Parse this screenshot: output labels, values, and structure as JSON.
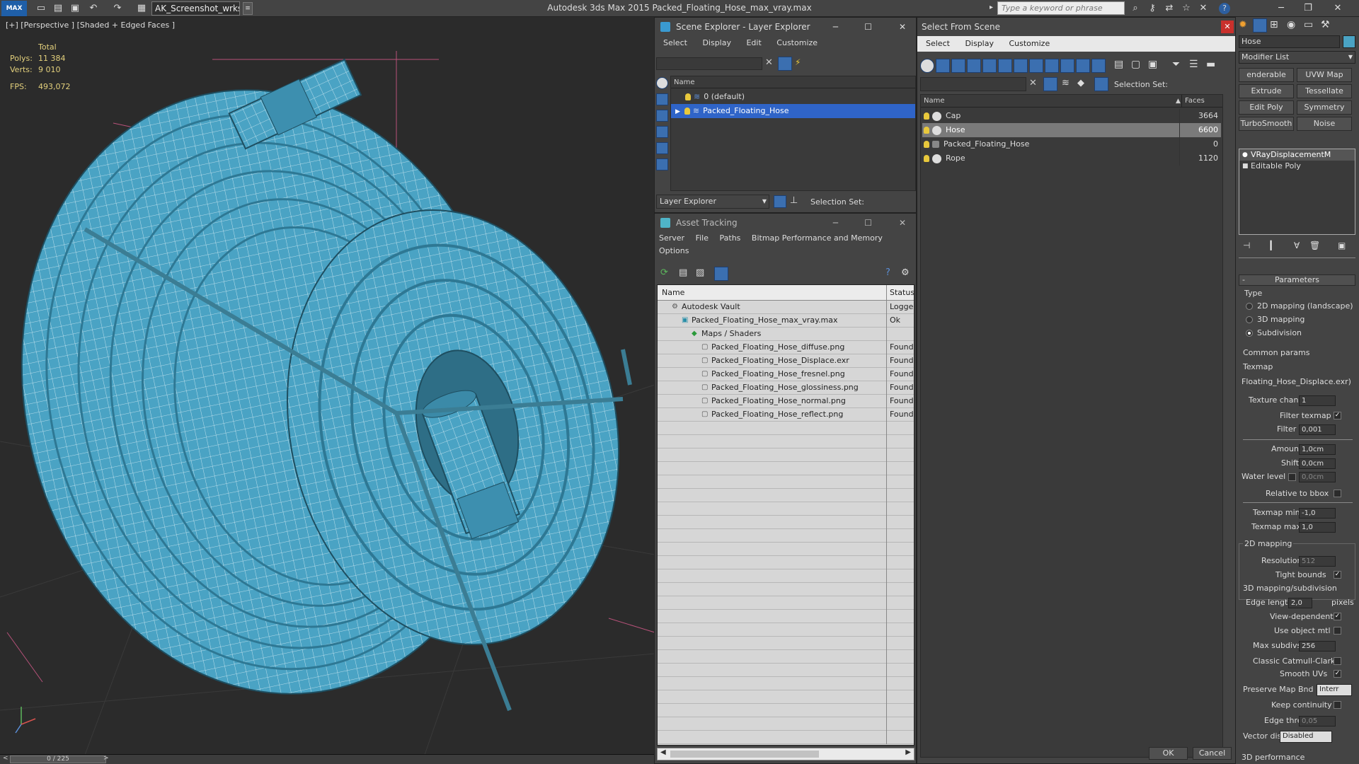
{
  "app": {
    "title": "Autodesk 3ds Max  2015     Packed_Floating_Hose_max_vray.max",
    "logo": "MAX",
    "workspace": "AK_Screenshot_wrksp",
    "search_placeholder": "Type a keyword or phrase"
  },
  "viewport": {
    "label": "[+] [Perspective ] [Shaded + Edged Faces ]",
    "stats": {
      "total_label": "Total",
      "polys_label": "Polys:",
      "polys": "11 384",
      "verts_label": "Verts:",
      "verts": "9 010",
      "fps_label": "FPS:",
      "fps": "493,072"
    },
    "timeline": "0 / 225"
  },
  "scene_explorer": {
    "title": "Scene Explorer - Layer Explorer",
    "menu": [
      "Select",
      "Display",
      "Edit",
      "Customize"
    ],
    "col_name": "Name",
    "rows": [
      "0 (default)",
      "Packed_Floating_Hose"
    ],
    "footer_dropdown": "Layer Explorer",
    "selection_set_label": "Selection Set:"
  },
  "asset_tracking": {
    "title": "Asset Tracking",
    "menu": [
      "Server",
      "File",
      "Paths",
      "Bitmap Performance and Memory"
    ],
    "menu2": "Options",
    "col_name": "Name",
    "col_status": "Status",
    "rows": [
      {
        "name": "Autodesk Vault",
        "status": "Logged"
      },
      {
        "name": "Packed_Floating_Hose_max_vray.max",
        "status": "Ok"
      },
      {
        "name": "Maps / Shaders",
        "status": ""
      },
      {
        "name": "Packed_Floating_Hose_diffuse.png",
        "status": "Found"
      },
      {
        "name": "Packed_Floating_Hose_Displace.exr",
        "status": "Found"
      },
      {
        "name": "Packed_Floating_Hose_fresnel.png",
        "status": "Found"
      },
      {
        "name": "Packed_Floating_Hose_glossiness.png",
        "status": "Found"
      },
      {
        "name": "Packed_Floating_Hose_normal.png",
        "status": "Found"
      },
      {
        "name": "Packed_Floating_Hose_reflect.png",
        "status": "Found"
      }
    ]
  },
  "select_from_scene": {
    "title": "Select From Scene",
    "menu": [
      "Select",
      "Display",
      "Customize"
    ],
    "selection_set_label": "Selection Set:",
    "col_name": "Name",
    "col_faces": "Faces",
    "rows": [
      {
        "name": "Cap",
        "faces": "3664"
      },
      {
        "name": "Hose",
        "faces": "6600"
      },
      {
        "name": "Packed_Floating_Hose",
        "faces": "0"
      },
      {
        "name": "Rope",
        "faces": "1120"
      }
    ],
    "ok": "OK",
    "cancel": "Cancel"
  },
  "command_panel": {
    "object_name": "Hose",
    "modifier_list": "Modifier List",
    "mod_buttons": [
      "enderable Spli",
      "UVW Map",
      "Extrude",
      "Tessellate",
      "Edit Poly",
      "Symmetry",
      "TurboSmooth",
      "Noise"
    ],
    "stack": [
      "VRayDisplacementM",
      "Editable Poly"
    ],
    "params_title": "Parameters",
    "type_label": "Type",
    "type_options": [
      "2D mapping (landscape)",
      "3D mapping",
      "Subdivision"
    ],
    "common_params": "Common params",
    "texmap_label": "Texmap",
    "texmap_value": "Floating_Hose_Displace.exr)",
    "texture_chan_label": "Texture chan",
    "texture_chan": "1",
    "filter_texmap_label": "Filter texmap",
    "filter_blur_label": "Filter blur",
    "filter_blur": "0,001",
    "amount_label": "Amount",
    "amount": "1,0cm",
    "shift_label": "Shift",
    "shift": "0,0cm",
    "water_level_label": "Water level",
    "water_level": "0,0cm",
    "relative_bbox_label": "Relative to bbox",
    "texmap_min_label": "Texmap min",
    "texmap_min": "-1,0",
    "texmap_max_label": "Texmap max",
    "texmap_max": "1,0",
    "mapping2d_title": "2D mapping",
    "resolution_label": "Resolution",
    "resolution": "512",
    "tight_bounds_label": "Tight bounds",
    "mapping3d_title": "3D mapping/subdivision",
    "edge_length_label": "Edge length",
    "edge_length": "2,0",
    "pixels_label": "pixels",
    "view_dependent_label": "View-dependent",
    "use_object_mtl_label": "Use object mtl",
    "max_subdivs_label": "Max subdivs",
    "max_subdivs": "256",
    "classic_cc_label": "Classic Catmull-Clark",
    "smooth_uvs_label": "Smooth UVs",
    "preserve_map_label": "Preserve Map Bnd",
    "preserve_map": "Interr",
    "keep_continuity_label": "Keep continuity",
    "edge_thresh_label": "Edge thresh",
    "edge_thresh": "0,05",
    "vector_displ_label": "Vector displ",
    "vector_displ": "Disabled",
    "perf_title": "3D performance"
  },
  "colors": {
    "hose": "#4aa3c4",
    "selection": "#2f64c8",
    "accent_bulb": "#e8c83c"
  }
}
